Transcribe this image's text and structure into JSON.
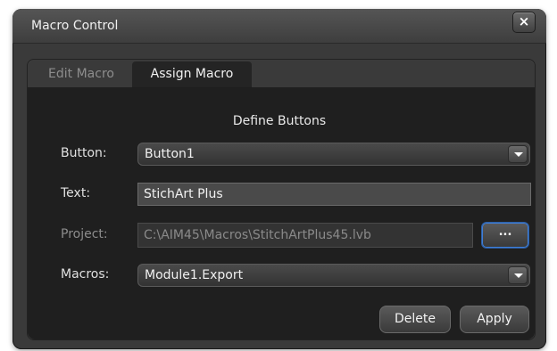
{
  "window": {
    "title": "Macro Control",
    "close_symbol": "×"
  },
  "tabs": [
    {
      "label": "Edit Macro",
      "active": false
    },
    {
      "label": "Assign Macro",
      "active": true
    }
  ],
  "form": {
    "section_title": "Define Buttons",
    "button": {
      "label": "Button:",
      "value": "Button1"
    },
    "text": {
      "label": "Text:",
      "value": "StichArt Plus"
    },
    "project": {
      "label": "Project:",
      "value": "C:\\AIM45\\Macros\\StitchArtPlus45.lvb",
      "browse_label": "..."
    },
    "macros": {
      "label": "Macros:",
      "value": "Module1.Export"
    }
  },
  "actions": {
    "delete_label": "Delete",
    "apply_label": "Apply"
  },
  "colors": {
    "window_bg": "#3a3a3a",
    "content_bg": "#1f1f1f",
    "focus_border": "#3f7fd8"
  },
  "icons": {
    "close": "close-icon",
    "dropdown": "chevron-down-icon"
  }
}
